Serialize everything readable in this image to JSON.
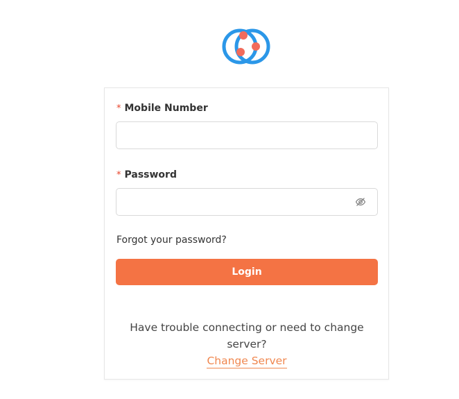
{
  "logo": {
    "icon": "app-logo-icon",
    "ring_color": "#2b97e8",
    "dot_color": "#f26b5b"
  },
  "form": {
    "mobile_label": "Mobile Number",
    "mobile_value": "",
    "mobile_placeholder": "",
    "password_label": "Password",
    "password_value": "",
    "password_placeholder": "",
    "required_marker": "*",
    "toggle_icon": "eye-off-icon",
    "forgot_link": "Forgot your password?",
    "login_button": "Login"
  },
  "footer": {
    "trouble_text": "Have trouble connecting or need to change server?",
    "change_server_link": "Change Server"
  },
  "colors": {
    "accent": "#f47344",
    "link_accent": "#f0874f",
    "required": "#e8452c"
  }
}
